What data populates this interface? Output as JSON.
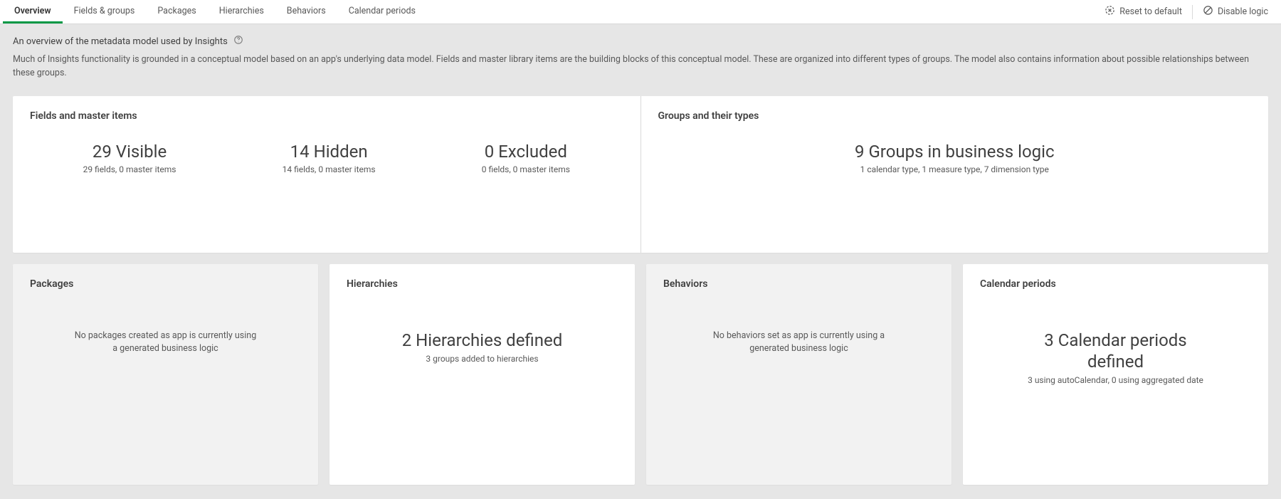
{
  "tabs": [
    {
      "label": "Overview",
      "active": true
    },
    {
      "label": "Fields & groups",
      "active": false
    },
    {
      "label": "Packages",
      "active": false
    },
    {
      "label": "Hierarchies",
      "active": false
    },
    {
      "label": "Behaviors",
      "active": false
    },
    {
      "label": "Calendar periods",
      "active": false
    }
  ],
  "actions": {
    "reset": "Reset to default",
    "disable": "Disable logic"
  },
  "intro": {
    "title": "An overview of the metadata model used by Insights",
    "desc": "Much of Insights functionality is grounded in a conceptual model based on an app's underlying data model. Fields and master library items are the building blocks of this conceptual model. These are organized into different types of groups. The model also contains information about possible relationships between these groups."
  },
  "sections": {
    "fields": {
      "title": "Fields and master items",
      "visible": {
        "main": "29 Visible",
        "sub": "29 fields, 0 master items"
      },
      "hidden": {
        "main": "14 Hidden",
        "sub": "14 fields, 0 master items"
      },
      "excluded": {
        "main": "0 Excluded",
        "sub": "0 fields, 0 master items"
      }
    },
    "groups": {
      "title": "Groups and their types",
      "main": "9 Groups in business logic",
      "sub": "1 calendar type, 1 measure type, 7 dimension type"
    },
    "packages": {
      "title": "Packages",
      "empty": "No packages created as app is currently using a generated business logic"
    },
    "hierarchies": {
      "title": "Hierarchies",
      "main": "2 Hierarchies defined",
      "sub": "3 groups added to hierarchies"
    },
    "behaviors": {
      "title": "Behaviors",
      "empty": "No behaviors set as app is currently using a generated business logic"
    },
    "calendar": {
      "title": "Calendar periods",
      "main": "3 Calendar periods defined",
      "sub": "3 using autoCalendar, 0 using aggregated date"
    }
  }
}
